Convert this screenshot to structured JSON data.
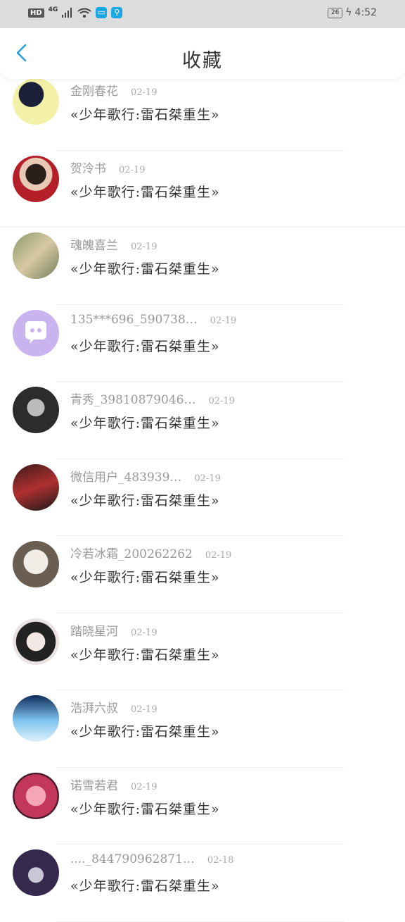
{
  "status_bar": {
    "hd": "HD",
    "network": "4G",
    "battery": "26",
    "time": "4:52"
  },
  "header": {
    "title": "收藏"
  },
  "items": [
    {
      "username": "金刚春花",
      "date": "02-19",
      "subtitle": "«少年歌行:雷石桀重生»",
      "avatar": "avatar-photo-1"
    },
    {
      "username": "贺泠书",
      "date": "02-19",
      "subtitle": "«少年歌行:雷石桀重生»",
      "avatar": "avatar-photo-2"
    },
    {
      "username": "魂魄喜兰",
      "date": "02-19",
      "subtitle": "«少年歌行:雷石桀重生»",
      "avatar": "avatar-photo-3"
    },
    {
      "username": "135***696_590738…",
      "date": "02-19",
      "subtitle": "«少年歌行:雷石桀重生»",
      "avatar": "avatar-default-chat"
    },
    {
      "username": "青秀_39810879046…",
      "date": "02-19",
      "subtitle": "«少年歌行:雷石桀重生»",
      "avatar": "avatar-photo-5"
    },
    {
      "username": "微信用户_483939…",
      "date": "02-19",
      "subtitle": "«少年歌行:雷石桀重生»",
      "avatar": "avatar-photo-6"
    },
    {
      "username": "冷若冰霜_200262262",
      "date": "02-19",
      "subtitle": "«少年歌行:雷石桀重生»",
      "avatar": "avatar-photo-7"
    },
    {
      "username": "踏晓星河",
      "date": "02-19",
      "subtitle": "«少年歌行:雷石桀重生»",
      "avatar": "avatar-photo-8"
    },
    {
      "username": "浩湃六叔",
      "date": "02-19",
      "subtitle": "«少年歌行:雷石桀重生»",
      "avatar": "avatar-photo-9"
    },
    {
      "username": "诺雪若君",
      "date": "02-19",
      "subtitle": "«少年歌行:雷石桀重生»",
      "avatar": "avatar-photo-10"
    },
    {
      "username": "...._844790962871…",
      "date": "02-18",
      "subtitle": "«少年歌行:雷石桀重生»",
      "avatar": "avatar-photo-11"
    }
  ]
}
